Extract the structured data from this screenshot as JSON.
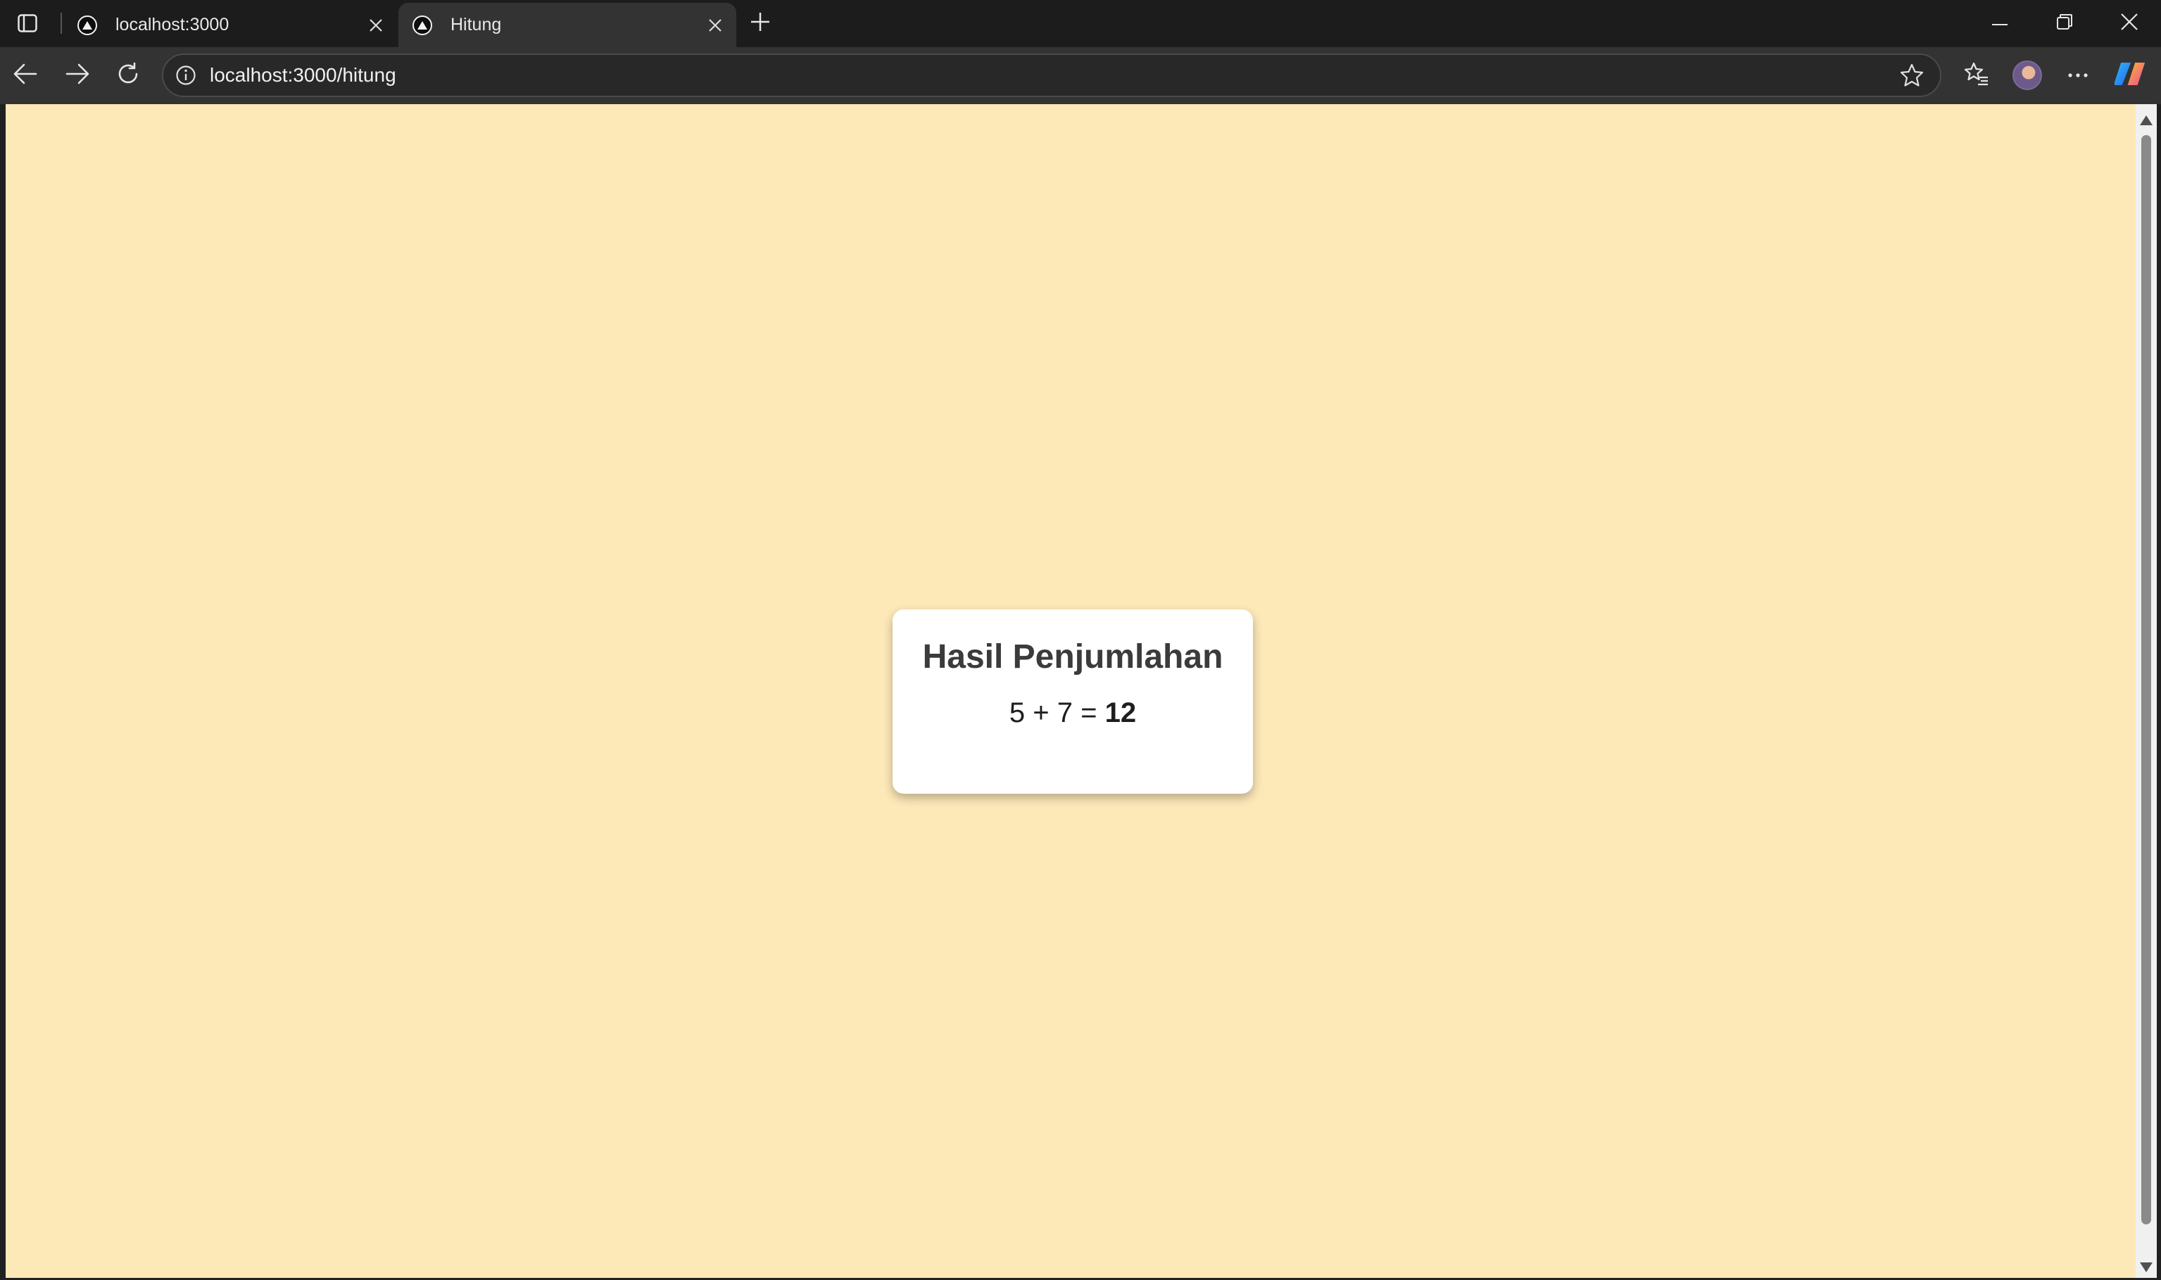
{
  "browser": {
    "tabs": [
      {
        "title": "localhost:3000",
        "active": false
      },
      {
        "title": "Hitung",
        "active": true
      }
    ],
    "address": "localhost:3000/hitung",
    "icons": {
      "sidebar": "sidebar-toggle-icon",
      "favicon": "triangle-icon",
      "close": "close-icon",
      "new_tab": "plus-icon",
      "back": "back-arrow-icon",
      "forward": "forward-arrow-icon",
      "refresh": "refresh-icon",
      "info": "info-icon",
      "favorite": "star-icon",
      "favorites": "favorites-list-icon",
      "more": "more-icon",
      "copilot": "copilot-icon"
    }
  },
  "page": {
    "background": "#fde8b8",
    "card": {
      "title": "Hasil Penjumlahan",
      "a": "5",
      "plus": "+",
      "b": "7",
      "equals": "=",
      "sum": "12"
    }
  }
}
